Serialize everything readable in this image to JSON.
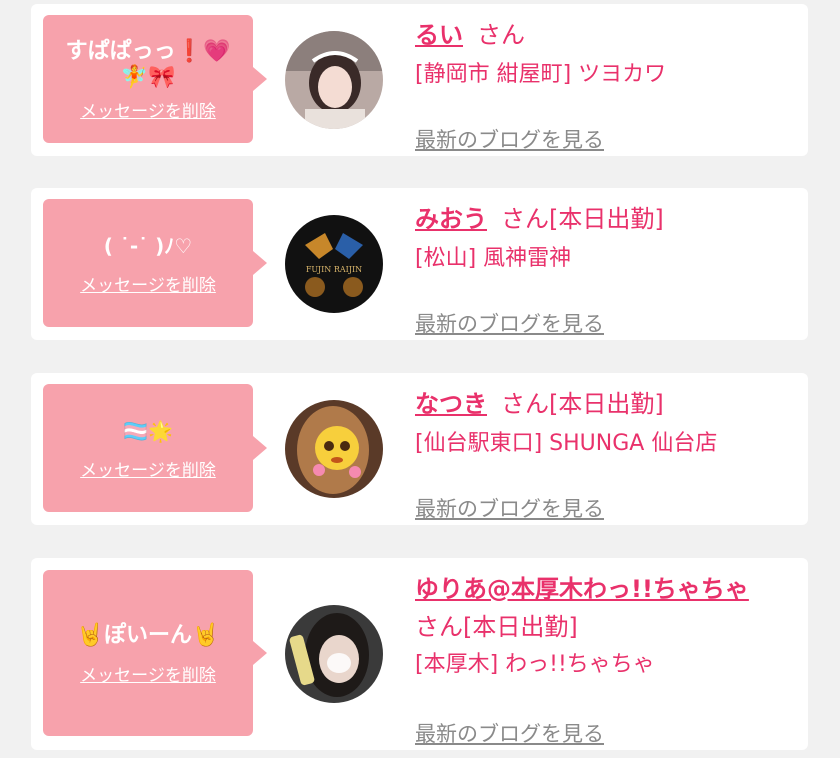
{
  "delete_label": "メッセージを削除",
  "san_label": "さん",
  "blog_label": "最新のブログを見る",
  "cards": [
    {
      "message_line1": "すぱぱっっ❗💗",
      "message_line2": "🧚🎀",
      "name": "るい",
      "status": "",
      "shop": "[静岡市 紺屋町] ツヨカワ",
      "avatar_icon": "girl-portrait"
    },
    {
      "message_line1": "( ˙-˙ )ﾉ♡",
      "message_line2": "",
      "name": "みおう",
      "status": "[本日出勤]",
      "shop": "[松山] 風神雷神",
      "avatar_icon": "fujin-raijin-logo",
      "avatar_logo_text": "FUJIN RAIJIN"
    },
    {
      "message_line1": "🏳️‍⚧️🌟",
      "message_line2": "",
      "name": "なつき",
      "status": "[本日出勤]",
      "shop": "[仙台駅東口] SHUNGA 仙台店",
      "avatar_icon": "emoji-covered-portrait"
    },
    {
      "message_line1": "🤘ぽいーん🤘",
      "message_line2": "",
      "name": "ゆりあ@本厚木わっ!!ちゃちゃ",
      "status": "[本日出勤]",
      "shop": "[本厚木] わっ!!ちゃちゃ",
      "avatar_icon": "blurred-face-portrait"
    }
  ]
}
